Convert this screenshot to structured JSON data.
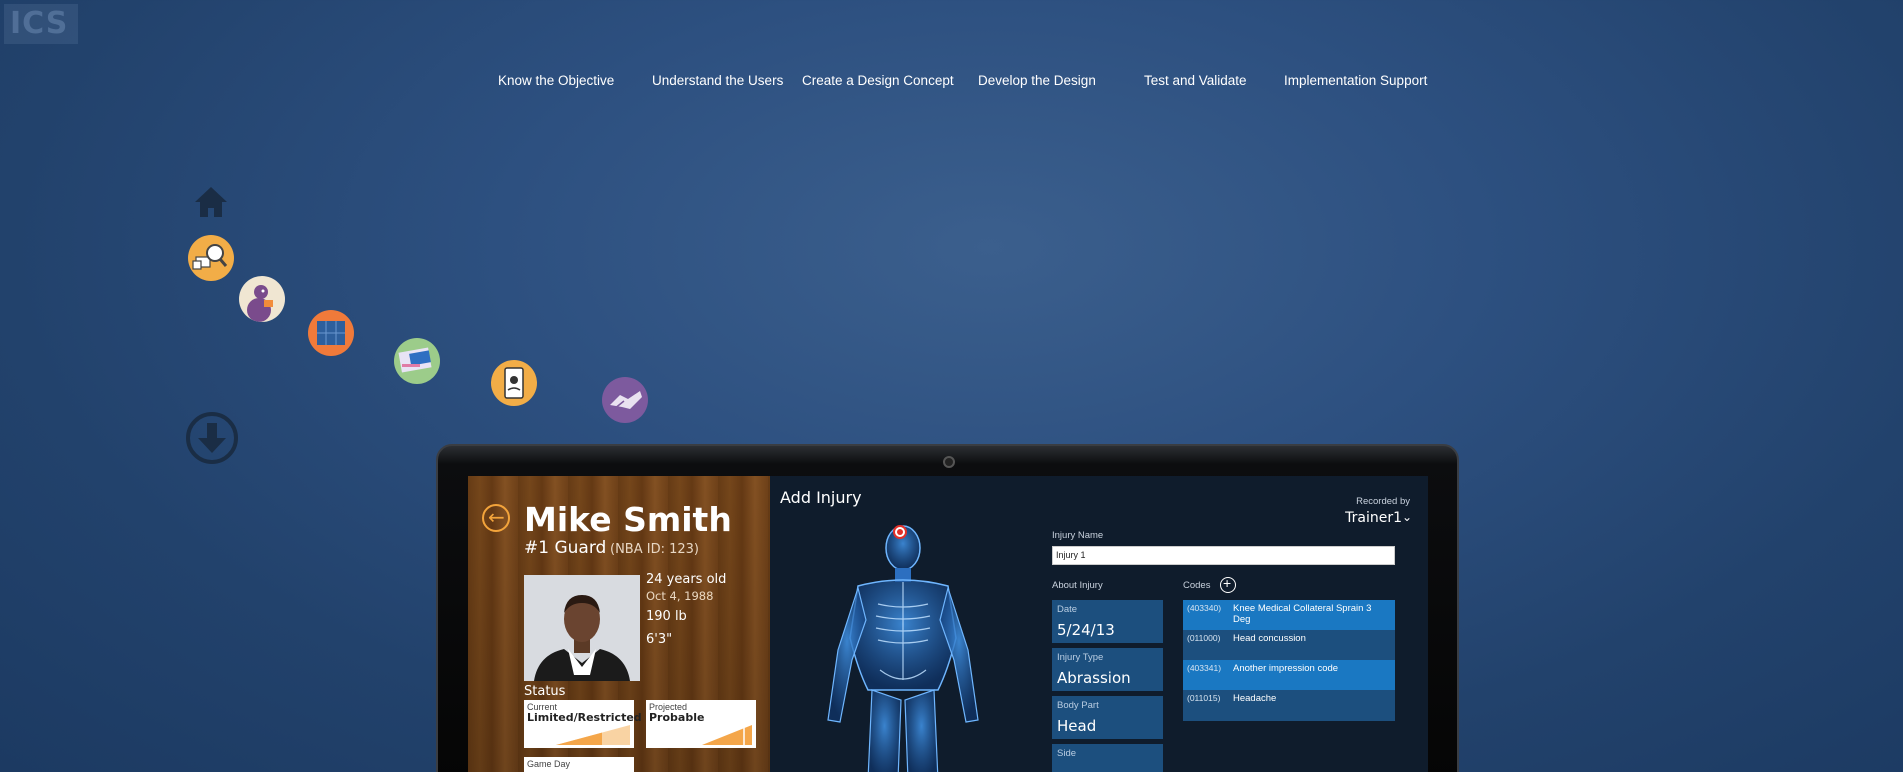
{
  "brand": {
    "logo_text": "ICS"
  },
  "nav": {
    "items": [
      {
        "label": "Know the Objective"
      },
      {
        "label": "Understand the Users"
      },
      {
        "label": "Create a Design Concept"
      },
      {
        "label": "Develop the Design"
      },
      {
        "label": "Test and Validate"
      },
      {
        "label": "Implementation Support"
      }
    ]
  },
  "side_icons": {
    "home": "home-icon",
    "steps": [
      "magnifier-icon",
      "user-research-icon",
      "concept-icon",
      "design-icon",
      "testing-icon",
      "handshake-icon"
    ],
    "scroll_down": "arrow-down-circle-icon"
  },
  "app": {
    "player": {
      "name": "Mike Smith",
      "role": "#1 Guard",
      "id": "(NBA ID: 123)",
      "age": "24 years old",
      "dob": "Oct 4, 1988",
      "weight": "190 lb",
      "height": "6'3\""
    },
    "status": {
      "title": "Status",
      "current_label": "Current",
      "current_value": "Limited/Restricted",
      "projected_label": "Projected",
      "projected_value": "Probable",
      "gameday_label": "Game Day"
    },
    "injury": {
      "title": "Add Injury",
      "recorded_by_label": "Recorded by",
      "recorded_by_value": "Trainer1",
      "name_label": "Injury Name",
      "name_value": "Injury 1",
      "about_label": "About Injury",
      "codes_label": "Codes",
      "about": [
        {
          "label": "Date",
          "value": "5/24/13"
        },
        {
          "label": "Injury Type",
          "value": "Abrassion"
        },
        {
          "label": "Body Part",
          "value": "Head"
        },
        {
          "label": "Side",
          "value": ""
        }
      ],
      "codes": [
        {
          "code": "(403340)",
          "desc": "Knee Medical Collateral Sprain 3 Deg",
          "selected": true
        },
        {
          "code": "(011000)",
          "desc": "Head concussion",
          "selected": false
        },
        {
          "code": "(403341)",
          "desc": "Another impression code",
          "selected": true
        },
        {
          "code": "(011015)",
          "desc": "Headache",
          "selected": false
        }
      ]
    }
  },
  "colors": {
    "background": "#2d5080",
    "accent_orange": "#f3a43b",
    "card_blue": "#1c4f7e",
    "selected_blue": "#1a78c2"
  }
}
